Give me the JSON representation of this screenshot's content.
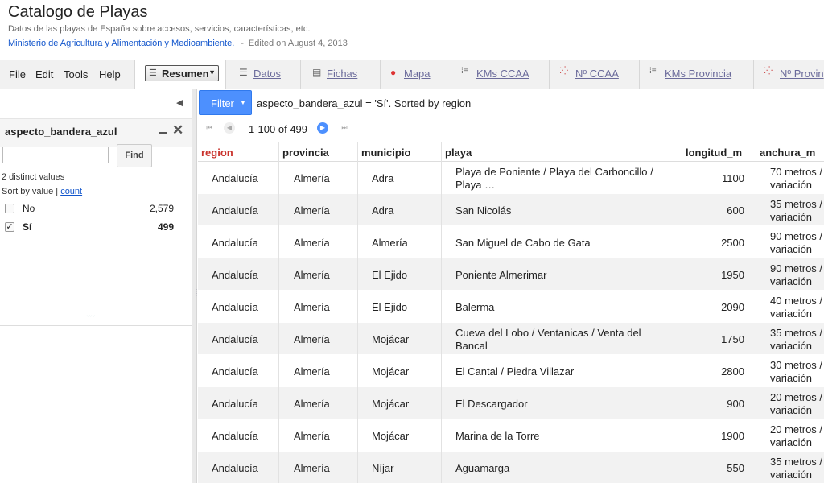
{
  "app": {
    "title": "Catalogo de Playas",
    "subtitle": "Datos de las playas de España sobre accesos, servicios, características, etc.",
    "owner": "Ministerio de Agricultura y Alimentación y Medioambiente.",
    "separator": "-",
    "edited": "Edited on August 4, 2013"
  },
  "menu": [
    "File",
    "Edit",
    "Tools",
    "Help"
  ],
  "tabs": [
    {
      "label": "Resumen",
      "icon": "table-icon",
      "active": true
    },
    {
      "label": "Datos",
      "icon": "table-icon"
    },
    {
      "label": "Fichas",
      "icon": "cards-icon"
    },
    {
      "label": "Mapa",
      "icon": "map-pin-icon"
    },
    {
      "label": "KMs CCAA",
      "icon": "bar-chart-icon"
    },
    {
      "label": "Nº CCAA",
      "icon": "scatter-chart-icon"
    },
    {
      "label": "KMs Provincia",
      "icon": "bar-chart-icon"
    },
    {
      "label": "Nº Provin",
      "icon": "scatter-chart-icon"
    }
  ],
  "facet": {
    "title": "aspecto_bandera_azul",
    "find_label": "Find",
    "search_value": "",
    "distinct": "2 distinct values",
    "sort_prefix": "Sort by value |",
    "sort_count": "count",
    "values": [
      {
        "label": "No",
        "count": "2,579",
        "checked": false
      },
      {
        "label": "Sí",
        "count": "499",
        "checked": true
      }
    ]
  },
  "filter": {
    "button_label": "Filter",
    "description": "aspecto_bandera_azul = 'Sí'. Sorted by region"
  },
  "pager": {
    "text": "1-100 of 499"
  },
  "table": {
    "columns": [
      "region",
      "provincia",
      "municipio",
      "playa",
      "longitud_m",
      "anchura_m"
    ],
    "sorted_column": "region",
    "rows": [
      [
        "Andalucía",
        "Almería",
        "Adra",
        "Playa de Poniente / Playa del Carboncillo /",
        "Playa …",
        "1100",
        "70 metros /",
        "variación"
      ],
      [
        "Andalucía",
        "Almería",
        "Adra",
        "San Nicolás",
        "",
        "600",
        "35 metros /",
        "variación"
      ],
      [
        "Andalucía",
        "Almería",
        "Almería",
        "San Miguel de Cabo de Gata",
        "",
        "2500",
        "90 metros /",
        "variación"
      ],
      [
        "Andalucía",
        "Almería",
        "El Ejido",
        "Poniente Almerimar",
        "",
        "1950",
        "90 metros /",
        "variación"
      ],
      [
        "Andalucía",
        "Almería",
        "El Ejido",
        "Balerma",
        "",
        "2090",
        "40 metros /",
        "variación"
      ],
      [
        "Andalucía",
        "Almería",
        "Mojácar",
        "Cueva del Lobo / Ventanicas / Venta del",
        "Bancal",
        "1750",
        "35 metros /",
        "variación"
      ],
      [
        "Andalucía",
        "Almería",
        "Mojácar",
        "El Cantal / Piedra Villazar",
        "",
        "2800",
        "30 metros /",
        "variación"
      ],
      [
        "Andalucía",
        "Almería",
        "Mojácar",
        "El Descargador",
        "",
        "900",
        "20 metros /",
        "variación"
      ],
      [
        "Andalucía",
        "Almería",
        "Mojácar",
        "Marina de la Torre",
        "",
        "1900",
        "20 metros /",
        "variación"
      ],
      [
        "Andalucía",
        "Almería",
        "Níjar",
        "Aguamarga",
        "",
        "550",
        "35 metros /",
        "variación"
      ]
    ]
  },
  "colors": {
    "accent": "#4d90fe",
    "sorted_header": "#c9312b",
    "link": "#1155cc"
  }
}
